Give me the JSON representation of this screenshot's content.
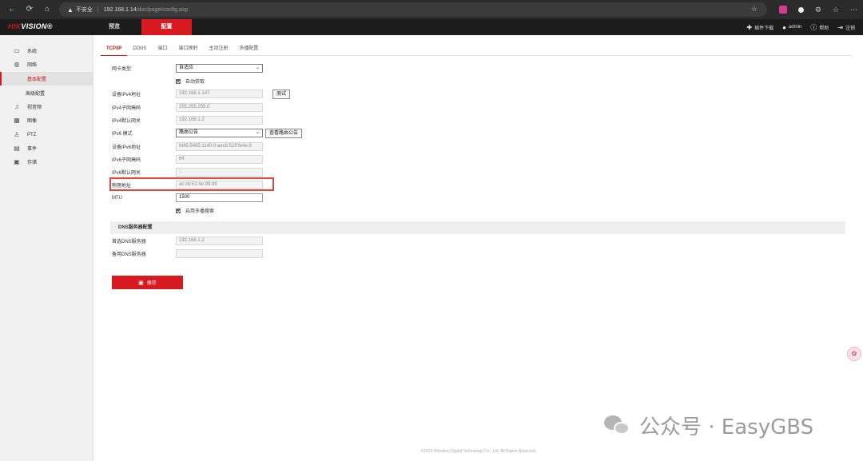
{
  "browser": {
    "back": "←",
    "reload": "⟳",
    "home": "⌂",
    "security_warning": "不安全",
    "url_host": "192.168.1.14",
    "url_path": "/doc/page/config.asp"
  },
  "header": {
    "logo_red": "HIK",
    "logo_white": "VISION",
    "logo_mark": "®",
    "tabs": [
      "预览",
      "配置"
    ],
    "right_items": [
      {
        "icon": "plugin-icon",
        "label": "插件下载"
      },
      {
        "icon": "user-icon",
        "label": "admin"
      },
      {
        "icon": "help-icon",
        "label": "帮助"
      },
      {
        "icon": "logout-icon",
        "label": "注销"
      }
    ]
  },
  "sidebar": {
    "items": [
      {
        "label": "系统"
      },
      {
        "label": "网络"
      },
      {
        "label": "基本配置"
      },
      {
        "label": "高级配置"
      },
      {
        "label": "视音频"
      },
      {
        "label": "图像"
      },
      {
        "label": "PTZ"
      },
      {
        "label": "事件"
      },
      {
        "label": "存储"
      }
    ]
  },
  "tabs": [
    "TCP/IP",
    "DDNS",
    "端口",
    "端口映射",
    "主动注册",
    "多播配置"
  ],
  "form": {
    "nic_type_label": "网卡类型",
    "nic_type_value": "自适应",
    "auto_obtain_label": "自动获取",
    "ipv4_label": "设备IPv4地址",
    "ipv4_value": "192.168.1.147",
    "test_button": "测试",
    "mask_label": "IPv4子网掩码",
    "mask_value": "255.255.255.0",
    "gateway_label": "IPv4默认网关",
    "gateway_value": "192.168.1.2",
    "ipv6_mode_label": "IPv6 模式",
    "ipv6_mode_value": "路由公告",
    "view_route_button": "查看路由公告",
    "ipv6_addr_label": "设备IPv6地址",
    "ipv6_addr_value": "fd45:5465:1140:0:aecb:51ff:fe4e:9",
    "ipv6_prefix_label": "IPv6子网掩码",
    "ipv6_prefix_value": "64",
    "ipv6_gateway_label": "IPv6默认网关",
    "ipv6_gateway_value": "::",
    "mac_label": "物理地址",
    "mac_value": "ac:cb:51:4e:99:d9",
    "mtu_label": "MTU",
    "mtu_value": "1500",
    "multicast_label": "启用多播搜索"
  },
  "dns": {
    "section_title": "DNS服务器配置",
    "primary_label": "首选DNS服务器",
    "primary_value": "192.168.1.2",
    "secondary_label": "备用DNS服务器",
    "secondary_value": ""
  },
  "save_button": "保存",
  "footer": "©2019 Hikvision Digital Technology Co., Ltd. All Rights Reserved.",
  "watermark": "公众号 · EasyGBS"
}
